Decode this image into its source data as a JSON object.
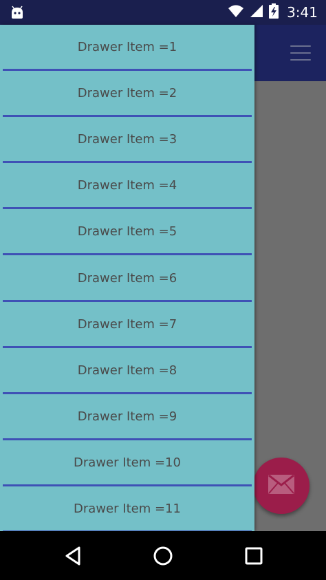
{
  "status_bar": {
    "time": "3:41",
    "icons": [
      "android-icon",
      "wifi-icon",
      "signal-icon",
      "battery-charging-icon"
    ]
  },
  "app_bar": {
    "menu_icon": "hamburger-menu-icon"
  },
  "drawer": {
    "items": [
      {
        "label": "Drawer Item =1"
      },
      {
        "label": "Drawer Item =2"
      },
      {
        "label": "Drawer Item =3"
      },
      {
        "label": "Drawer Item =4"
      },
      {
        "label": "Drawer Item =5"
      },
      {
        "label": "Drawer Item =6"
      },
      {
        "label": "Drawer Item =7"
      },
      {
        "label": "Drawer Item =8"
      },
      {
        "label": "Drawer Item =9"
      },
      {
        "label": "Drawer Item =10"
      },
      {
        "label": "Drawer Item =11"
      }
    ]
  },
  "fab": {
    "icon": "mail-icon"
  },
  "nav_bar": {
    "icons": [
      "back-icon",
      "home-icon",
      "recents-icon"
    ]
  },
  "colors": {
    "status_bar": "#1a1f4e",
    "app_bar": "#1c235f",
    "drawer_bg": "#74c0c8",
    "divider": "#3f51b5",
    "scrim": "#6e6e6e",
    "fab": "#9b1d4a"
  }
}
